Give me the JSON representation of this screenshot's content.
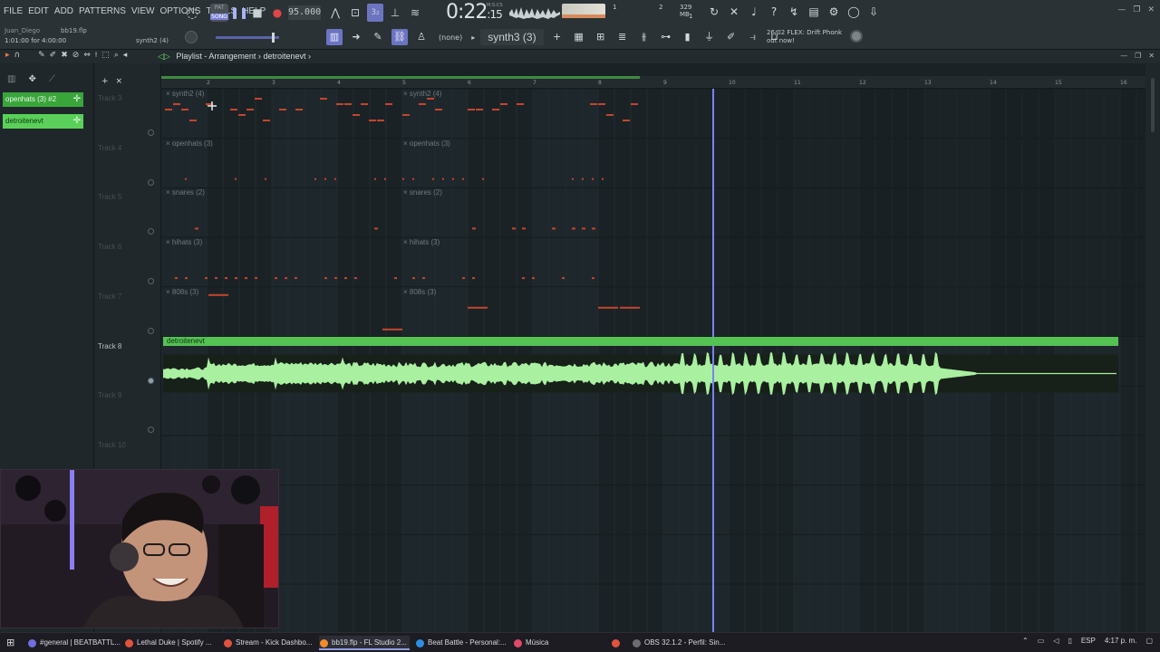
{
  "menu": [
    "FILE",
    "EDIT",
    "ADD",
    "PATTERNS",
    "VIEW",
    "OPTIONS",
    "TOOLS",
    "HELP"
  ],
  "transport": {
    "mode_label": "SONG",
    "pat_label": "PAT",
    "tempo": "95.000",
    "time_main": "0:22",
    "time_sub": ":15",
    "time_unit": "M:S:CS"
  },
  "monitor": {
    "cpu_count": "1",
    "voices": "2",
    "memory": "329 MB",
    "poly": "1"
  },
  "hint": {
    "user": "Juan_Diego",
    "file": "bb19.flp",
    "time_range": "1:01:00 for 4:00:00",
    "pattern": "synth2 (4)"
  },
  "toolbar2": {
    "snap": "(none)",
    "pattern_select": "synth3 (3)"
  },
  "news": {
    "date": "26/02",
    "line1": "FLEX: Drift Phonk",
    "line2": "out now!"
  },
  "playlist": {
    "title": "Playlist - Arrangement",
    "separator": "›",
    "arrangement": "detroitenevt"
  },
  "picker": [
    {
      "label": "openhats (3) #2"
    },
    {
      "label": "detroitenevt"
    }
  ],
  "tracks": [
    {
      "label": "Track 3"
    },
    {
      "label": "Track 4"
    },
    {
      "label": "Track 5"
    },
    {
      "label": "Track 6"
    },
    {
      "label": "Track 7"
    },
    {
      "label": "Track 8"
    },
    {
      "label": "Track 9"
    },
    {
      "label": "Track 10"
    }
  ],
  "bars": [
    "2",
    "3",
    "4",
    "5",
    "6",
    "7",
    "8",
    "9",
    "10",
    "11",
    "12",
    "13",
    "14",
    "15",
    "16"
  ],
  "clips": [
    {
      "track": 0,
      "name": "synth2 (4)"
    },
    {
      "track": 0,
      "name": "synth2 (4)"
    },
    {
      "track": 1,
      "name": "openhats (3)"
    },
    {
      "track": 1,
      "name": "openhats (3)"
    },
    {
      "track": 2,
      "name": "snares (2)"
    },
    {
      "track": 2,
      "name": "snares (2)"
    },
    {
      "track": 3,
      "name": "hihats (3)"
    },
    {
      "track": 3,
      "name": "hihats (3)"
    },
    {
      "track": 4,
      "name": "808s (3)"
    },
    {
      "track": 4,
      "name": "808s (3)"
    }
  ],
  "audio_clip": {
    "name": "detroitenevt",
    "track": 5
  },
  "colors": {
    "note_red": "#c4452c",
    "audio_green": "#55c254",
    "audio_wave": "#a9f0a0",
    "playhead": "#7b82f0",
    "accent_purple": "#6c74c2"
  },
  "taskbar": [
    {
      "label": "#general | BEATBATTL...",
      "color": "#6f6fe0"
    },
    {
      "label": "Lethal Duke | Spotify ...",
      "color": "#e0533d"
    },
    {
      "label": "Stream - Kick Dashbo...",
      "color": "#e0533d"
    },
    {
      "label": "bb19.flp - FL Studio 2...",
      "color": "#f28b2b"
    },
    {
      "label": "Beat Battle - Personal:...",
      "color": "#2d8fe0"
    },
    {
      "label": "Música",
      "color": "#e04a6a"
    },
    {
      "label": "",
      "color": "#e0533d"
    },
    {
      "label": "OBS 32.1.2 - Perfil: Sin...",
      "color": "#6c6c74"
    }
  ],
  "tray": {
    "lang": "ESP",
    "time": "4:17 p. m."
  }
}
